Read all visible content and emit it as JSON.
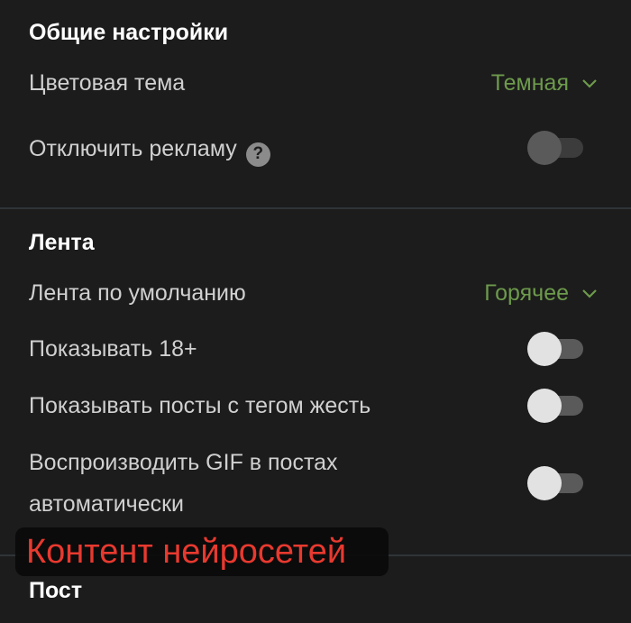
{
  "general": {
    "title": "Общие настройки",
    "theme_label": "Цветовая тема",
    "theme_value": "Темная",
    "ads_label": "Отключить рекламу",
    "help_glyph": "?",
    "ads_enabled": false
  },
  "feed": {
    "title": "Лента",
    "default_label": "Лента по умолчанию",
    "default_value": "Горячее",
    "adult_label": "Показывать 18+",
    "adult_enabled": false,
    "gore_label": "Показывать посты с тегом жесть",
    "gore_enabled": false,
    "gif_label_line1": "Воспроизводить GIF в постах",
    "gif_label_line2": "автоматически",
    "gif_enabled": false
  },
  "overlay": {
    "text": "Контент нейросетей"
  },
  "post": {
    "title": "Пост"
  },
  "colors": {
    "background": "#1c1c1c",
    "accent_green": "#6d9a4c",
    "overlay_red": "#e8392f",
    "divider": "#2f3438"
  },
  "icons": {
    "chevron": "chevron-down-icon",
    "help": "question-circle-icon"
  }
}
